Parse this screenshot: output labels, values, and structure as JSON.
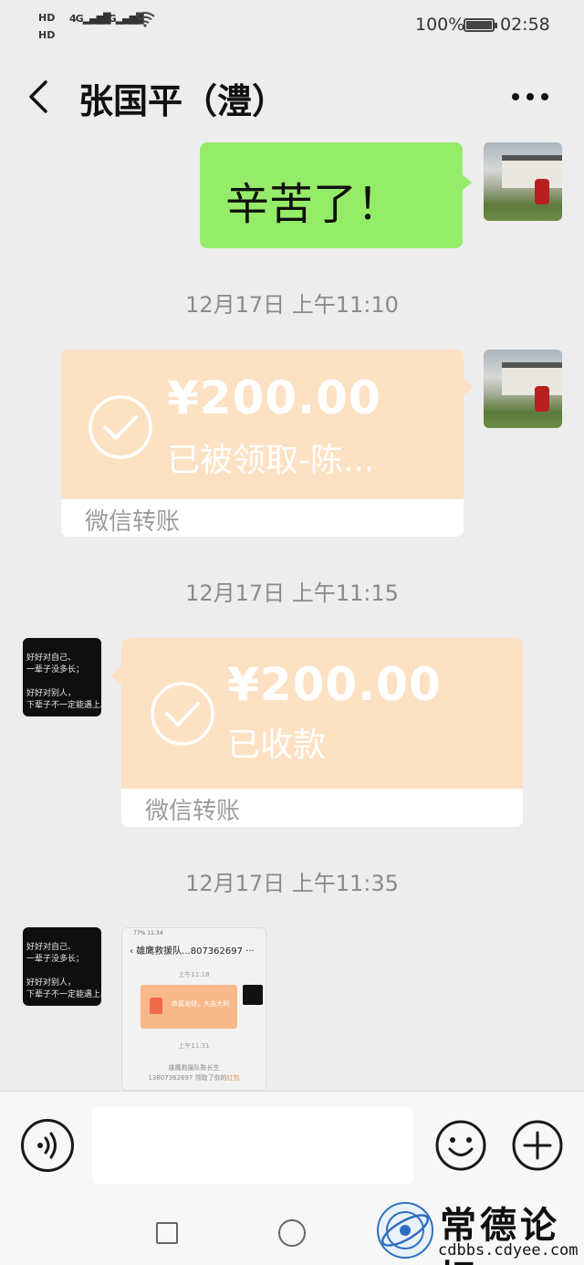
{
  "status_bar": {
    "hd1": "HD",
    "hd2": "HD",
    "signal1": "4G",
    "signal2": "4G",
    "battery_percent": "100%",
    "time": "02:58"
  },
  "header": {
    "title": "张国平（澧）"
  },
  "messages": {
    "m1_text": "辛苦了！",
    "ts1": "12月17日 上午11:10",
    "transfer1": {
      "amount": "¥200.00",
      "status": "已被领取-陈...",
      "footer": "微信转账"
    },
    "ts2": "12月17日 上午11:15",
    "transfer2": {
      "amount": "¥200.00",
      "status": "已收款",
      "footer": "微信转账"
    },
    "ts3": "12月17日 上午11:35",
    "avatar_other_text": "好好对自己、\n一辈子没多长；\n\n好好对别人，\n下辈子不一定能遇上。",
    "screenshot": {
      "status": "77% 11:34",
      "title": "雄鹰救援队...807362697 ···",
      "time1": "上午11:18",
      "card_text": "恭喜发财，大吉大利",
      "time2": "上午11:31",
      "note_line1": "雄鹰救援队陈长生",
      "note_line2": "13807362697 领取了你的",
      "note_highlight": "红包"
    }
  },
  "input": {
    "placeholder": ""
  },
  "watermark": {
    "brand": "常德论坛",
    "url": "cdbbs.cdyee.com"
  },
  "colors": {
    "chat_bg": "#ededed",
    "bubble_green": "#95ec69",
    "transfer_accepted": "#fde1c3",
    "text_gray": "#8a8a8a"
  }
}
